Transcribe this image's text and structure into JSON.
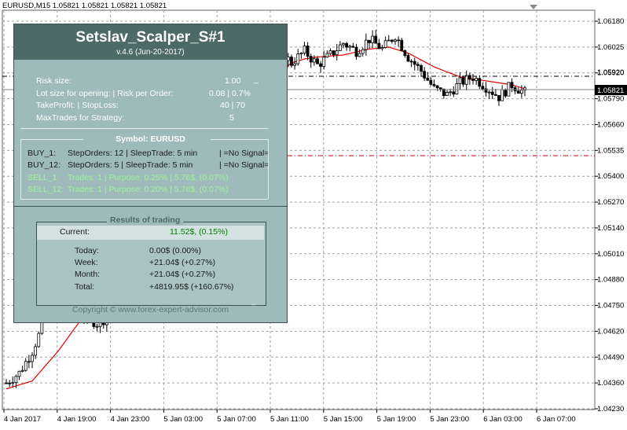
{
  "window": {
    "header": "EURUSD,M15  1.05821 1.05821 1.05821 1.05821"
  },
  "chart_data": {
    "type": "candlestick",
    "symbol": "EURUSD",
    "timeframe": "M15",
    "ohlc_header": [
      1.05821,
      1.05821,
      1.05821,
      1.05821
    ],
    "y_ticks": [
      "1.06180",
      "1.06025",
      "1.05920",
      "1.05790",
      "1.05660",
      "1.05535",
      "1.05400",
      "1.05270",
      "1.05140",
      "1.05010",
      "1.04880",
      "1.04750",
      "1.04620",
      "1.04490",
      "1.04360",
      "1.04230"
    ],
    "x_ticks": [
      "4 Jan 2017",
      "4 Jan 19:00",
      "4 Jan 23:00",
      "5 Jan 03:00",
      "5 Jan 07:00",
      "5 Jan 11:00",
      "5 Jan 15:00",
      "5 Jan 19:00",
      "5 Jan 23:00",
      "6 Jan 03:00",
      "6 Jan 07:00"
    ],
    "price_label": "1.05821",
    "level_label": "1.05920",
    "grid": true,
    "ylim": [
      1.0423,
      1.0618
    ],
    "close_path": [
      [
        0,
        1.0436
      ],
      [
        4,
        1.0441
      ],
      [
        8,
        1.0452
      ],
      [
        12,
        1.0468
      ],
      [
        16,
        1.0485
      ],
      [
        20,
        1.0478
      ],
      [
        24,
        1.047
      ],
      [
        28,
        1.0466
      ],
      [
        32,
        1.047
      ],
      [
        36,
        1.0487
      ],
      [
        40,
        1.0502
      ],
      [
        44,
        1.0496
      ],
      [
        48,
        1.0499
      ],
      [
        52,
        1.0506
      ],
      [
        56,
        1.0501
      ],
      [
        60,
        1.0508
      ],
      [
        64,
        1.0512
      ],
      [
        68,
        1.0526
      ],
      [
        72,
        1.0543
      ],
      [
        76,
        1.0566
      ],
      [
        80,
        1.0596
      ],
      [
        84,
        1.0604
      ],
      [
        88,
        1.0597
      ],
      [
        92,
        1.0603
      ],
      [
        96,
        1.0596
      ],
      [
        100,
        1.0601
      ],
      [
        104,
        1.0607
      ],
      [
        108,
        1.0603
      ],
      [
        112,
        1.0609
      ],
      [
        116,
        1.0604
      ],
      [
        120,
        1.0611
      ],
      [
        124,
        1.06
      ],
      [
        128,
        1.0593
      ],
      [
        132,
        1.0584
      ],
      [
        136,
        1.0581
      ],
      [
        140,
        1.0587
      ],
      [
        144,
        1.059
      ],
      [
        148,
        1.0585
      ],
      [
        152,
        1.058
      ],
      [
        156,
        1.0586
      ],
      [
        160,
        1.0582
      ]
    ],
    "ma_path": [
      [
        0,
        1.0433
      ],
      [
        8,
        1.0437
      ],
      [
        16,
        1.0452
      ],
      [
        24,
        1.047
      ],
      [
        32,
        1.0478
      ],
      [
        40,
        1.0489
      ],
      [
        48,
        1.0495
      ],
      [
        56,
        1.0499
      ],
      [
        60,
        1.0502
      ],
      [
        64,
        1.0508
      ],
      [
        68,
        1.0518
      ],
      [
        72,
        1.0535
      ],
      [
        76,
        1.0556
      ],
      [
        80,
        1.0577
      ],
      [
        84,
        1.0592
      ],
      [
        88,
        1.0597
      ],
      [
        92,
        1.0599
      ],
      [
        96,
        1.06
      ],
      [
        104,
        1.0601
      ],
      [
        112,
        1.0604
      ],
      [
        118,
        1.0605
      ],
      [
        124,
        1.0602
      ],
      [
        132,
        1.0595
      ],
      [
        140,
        1.059
      ],
      [
        148,
        1.0588
      ],
      [
        156,
        1.0586
      ],
      [
        160,
        1.0584
      ]
    ]
  },
  "panel": {
    "title": "Setslav_Scalper_S#1",
    "version": "v.4.6 (Jun-20-2017)",
    "params": [
      {
        "label": "Risk size:",
        "value": "1.00"
      },
      {
        "label": "Lot size for opening: | Risk per Order:",
        "value": "0.08  | 0.7%"
      },
      {
        "label": "TakeProfit: | StopLoss:",
        "value": "40 | 70"
      },
      {
        "label": "MaxTrades for Strategy:",
        "value": "5"
      }
    ],
    "symbol_header": "Symbol: EURUSD",
    "buy_rows": [
      {
        "name": "BUY_1:",
        "info": "StepOrders: 12  | SleepTrade: 5 min",
        "signal": "| =No Signal="
      },
      {
        "name": "BUY_12:",
        "info": "StepOrders: 5  | SleepTrade: 5 min",
        "signal": "| =No Signal="
      }
    ],
    "sell_rows": [
      {
        "name": "SELL_1:",
        "info": "Trades: 1 | Purpose: 0.25% | 5.76$, (0.07%)"
      },
      {
        "name": "SELL_12:",
        "info": "Trades: 1 | Purpose: 0.20%  | 5.76$, (0.07%)"
      }
    ],
    "results": {
      "header": "Results of trading",
      "current_label": "Current:",
      "current_value": "11.52$, (0.15%)",
      "rows": [
        {
          "label": "Today:",
          "value": "0.00$  (0.00%)"
        },
        {
          "label": "Week:",
          "value": "+21.04$  (+0.27%)"
        },
        {
          "label": "Month:",
          "value": "+21.04$  (+0.27%)"
        },
        {
          "label": "Total:",
          "value": "+4819.95$  (+160.67%)"
        }
      ]
    },
    "copyright": "Copyright © www.forex-expert-advisor.com"
  },
  "colors": {
    "ma": "#e00000",
    "grid": "#9a9a9a",
    "panel_bg": "#9fbaba",
    "panel_head": "#4d6a66",
    "green": "#008000"
  }
}
